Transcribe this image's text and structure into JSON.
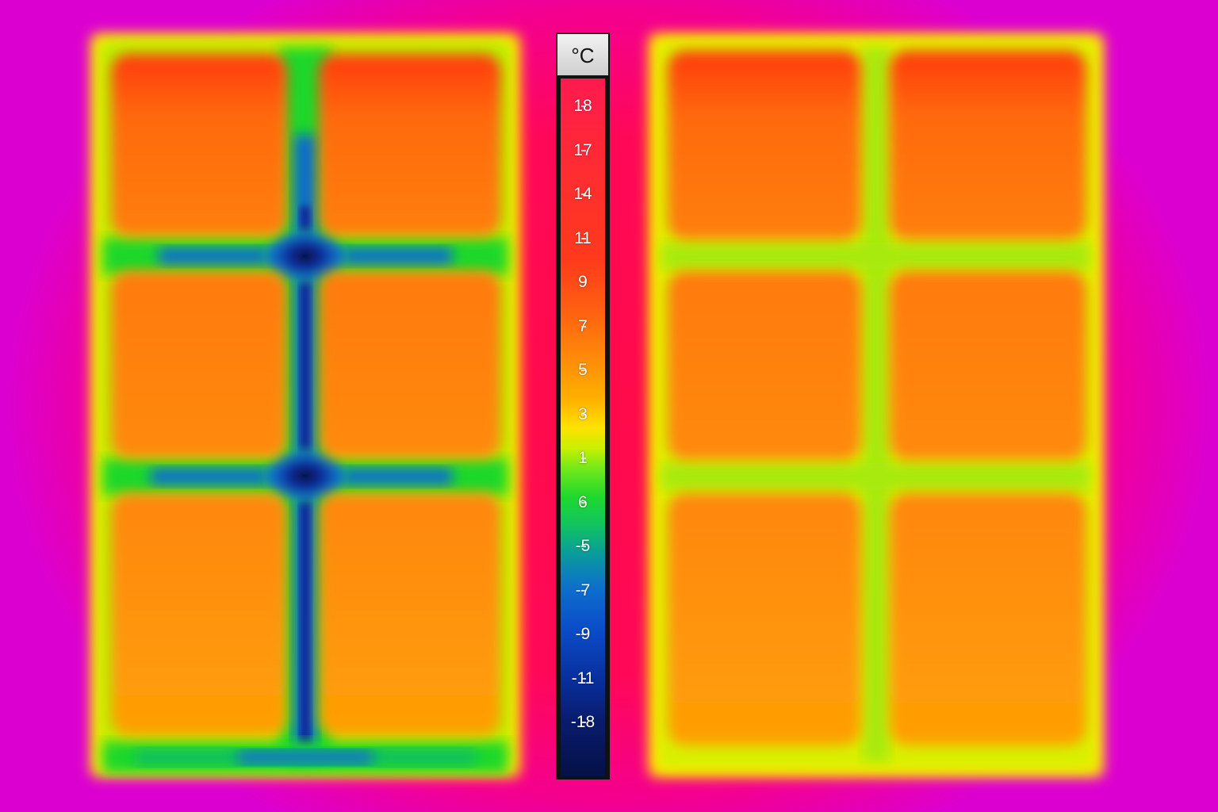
{
  "scale": {
    "unit": "°C",
    "labels": [
      "18",
      "17",
      "14",
      "11",
      "9",
      "7",
      "5",
      "3",
      "1",
      "6",
      "-5",
      "-7",
      "-9",
      "-11",
      "-18"
    ]
  },
  "windows": {
    "left": {
      "panes": 6,
      "mullion_cold_bridge": true
    },
    "right": {
      "panes": 6,
      "mullion_cold_bridge": false
    }
  },
  "palette": {
    "background_magenta": "#dc00d0",
    "wall_hot": "#ff0a4a",
    "pane_orange": "#ff8a0a",
    "frame_yellow": "#ffe100",
    "cold_blue": "#0a4cc8",
    "cold_dark": "#061048"
  }
}
